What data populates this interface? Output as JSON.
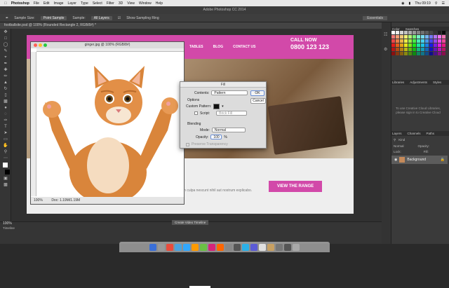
{
  "menubar": {
    "app": "Photoshop",
    "items": [
      "File",
      "Edit",
      "Image",
      "Layer",
      "Type",
      "Select",
      "Filter",
      "3D",
      "View",
      "Window",
      "Help"
    ],
    "clock": "Thu 09:19"
  },
  "titlebar": {
    "title": "Adobe Photoshop CC 2014"
  },
  "options": {
    "sample_size_label": "Sample Size:",
    "sample_size": "Point Sample",
    "sample_label": "Sample:",
    "sample": "All Layers",
    "show_ring": "Show Sampling Ring",
    "workspace": "Essentials"
  },
  "doc_tab": "footballsite.psd @ 100% (Rounded Rectangle 2, RGB/8#) *",
  "website": {
    "nav": [
      "TABLES",
      "BLOG",
      "CONTACT US"
    ],
    "call_now": "CALL NOW",
    "phone": "0800 123 123",
    "cta": "VIEW THE RANGE",
    "body_text": "em culpa nescunt nihil aut nostrum explicabo."
  },
  "cat_window": {
    "title": "ginger.jpg @ 100% (RGB/8#)",
    "zoom": "100%",
    "status": "Doc: 1.19M/1.19M"
  },
  "fill_dialog": {
    "title": "Fill",
    "contents_label": "Contents:",
    "contents_value": "Pattern",
    "ok": "OK",
    "cancel": "Cancel",
    "options_label": "Options",
    "custom_pattern_label": "Custom Pattern:",
    "script_label": "Script:",
    "script_value": "Brick Fill",
    "blending_label": "Blending",
    "mode_label": "Mode:",
    "mode_value": "Normal",
    "opacity_label": "Opacity:",
    "opacity_value": "100",
    "opacity_unit": "%",
    "preserve_label": "Preserve Transparency"
  },
  "panels": {
    "color_tabs": [
      "Color",
      "Swatches"
    ],
    "lib_tabs": [
      "Libraries",
      "Adjustments",
      "Styles"
    ],
    "libs_msg": "To use Creative Cloud Libraries, please sign in to Creative Cloud",
    "layer_tabs": [
      "Layers",
      "Channels",
      "Paths"
    ],
    "kind_label": "Kind",
    "normal_label": "Normal",
    "opacity_label": "Opacity:",
    "lock_label": "Lock:",
    "fill_label": "Fill:",
    "layer_name": "Background"
  },
  "timeline": {
    "title": "Timeline",
    "create_btn": "Create Video Timeline",
    "zoom": "100%"
  },
  "colors": {
    "accent": "#d249a9",
    "chrome": "#3a3a3a"
  }
}
